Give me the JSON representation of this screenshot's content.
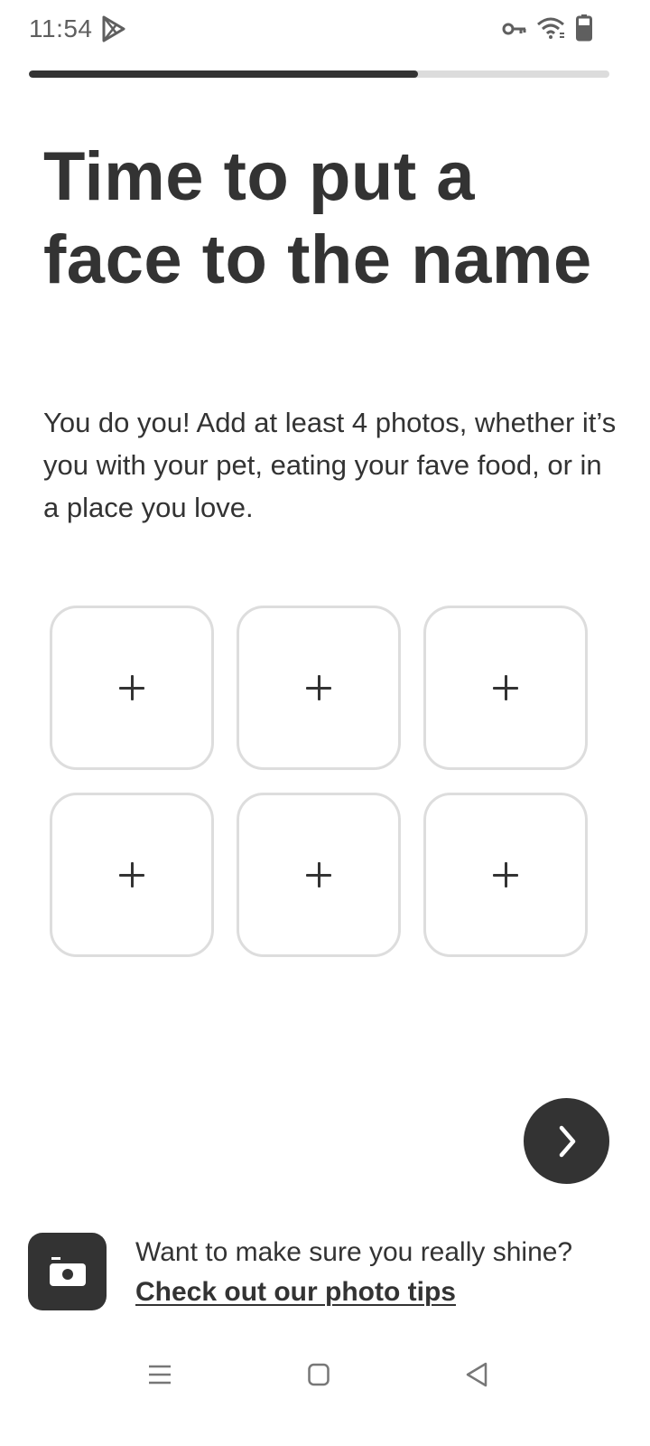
{
  "status_bar": {
    "time": "11:54",
    "icons": [
      "play-store-icon",
      "vpn-key-icon",
      "wifi-icon",
      "battery-icon"
    ]
  },
  "progress": {
    "fraction": 0.67,
    "fill_color": "#333333",
    "track_color": "#dcdcdc"
  },
  "heading": {
    "title": "Time to put a face to the name",
    "subtitle": "You do you! Add at least 4 photos, whether it’s you with your pet, eating your fave food, or in a place you love."
  },
  "photo_grid": {
    "slots": [
      {
        "icon": "plus-icon"
      },
      {
        "icon": "plus-icon"
      },
      {
        "icon": "plus-icon"
      },
      {
        "icon": "plus-icon"
      },
      {
        "icon": "plus-icon"
      },
      {
        "icon": "plus-icon"
      }
    ]
  },
  "next_button": {
    "icon": "chevron-right-icon"
  },
  "tips": {
    "icon": "camera-icon",
    "question": "Want to make sure you really shine?",
    "link": "Check out our photo tips"
  },
  "nav_bar": {
    "icons": [
      "menu-icon",
      "home-icon",
      "back-icon"
    ]
  },
  "colors": {
    "primary": "#333333",
    "slot_border": "#dddddd",
    "background": "#ffffff"
  }
}
